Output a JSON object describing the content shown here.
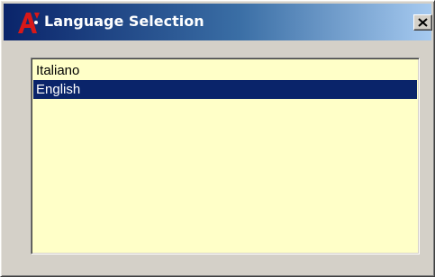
{
  "window": {
    "title": "Language Selection",
    "close_label": "Close"
  },
  "icons": {
    "app_logo": "app-logo-icon",
    "close": "close-x-icon"
  },
  "language_list": {
    "items": [
      {
        "label": "Italiano",
        "selected": false
      },
      {
        "label": "English",
        "selected": true
      }
    ]
  },
  "colors": {
    "title_bar_start": "#0a246a",
    "title_bar_end": "#a6caf0",
    "list_background": "#ffffc8",
    "selection": "#0a246a",
    "window_face": "#d4d0c8"
  }
}
